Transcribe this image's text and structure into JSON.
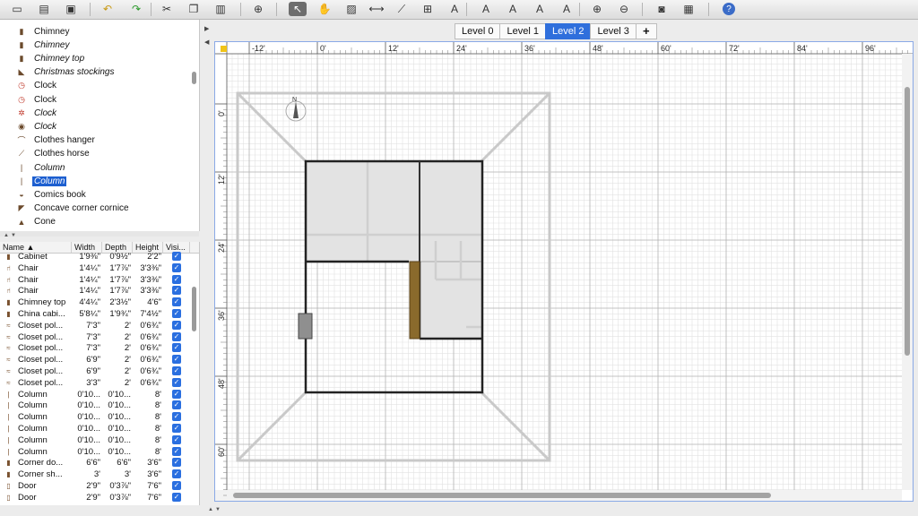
{
  "toolbar": {
    "icons": [
      "new-icon",
      "open-icon",
      "save-icon",
      "undo-icon",
      "redo-icon",
      "cut-icon",
      "copy-icon",
      "paste-icon",
      "add-furniture-icon",
      "select-icon",
      "pan-icon",
      "create-rooms-icon",
      "create-dimensions-icon",
      "create-polylines-icon",
      "create-walls-icon",
      "add-text-icon",
      "text-style-icon",
      "text-style-icon",
      "text-style-icon",
      "text-style-icon",
      "zoom-in-icon",
      "zoom-out-icon",
      "create-photo-icon",
      "create-video-icon",
      "help-icon"
    ]
  },
  "catalog": {
    "items": [
      {
        "label": "Chimney",
        "italic": false,
        "icon": "▮"
      },
      {
        "label": "Chimney",
        "italic": true,
        "icon": "▮"
      },
      {
        "label": "Chimney top",
        "italic": true,
        "icon": "▮"
      },
      {
        "label": "Christmas stockings",
        "italic": true,
        "icon": "◣"
      },
      {
        "label": "Clock",
        "italic": false,
        "icon": "◷"
      },
      {
        "label": "Clock",
        "italic": false,
        "icon": "◷"
      },
      {
        "label": "Clock",
        "italic": true,
        "icon": "✲"
      },
      {
        "label": "Clock",
        "italic": true,
        "icon": "◉"
      },
      {
        "label": "Clothes hanger",
        "italic": false,
        "icon": "⌒"
      },
      {
        "label": "Clothes horse",
        "italic": false,
        "icon": "⟋"
      },
      {
        "label": "Column",
        "italic": true,
        "icon": "|"
      },
      {
        "label": "Column",
        "italic": true,
        "icon": "|",
        "selected": true
      },
      {
        "label": "Comics book",
        "italic": false,
        "icon": "◒"
      },
      {
        "label": "Concave corner cornice",
        "italic": false,
        "icon": "◤"
      },
      {
        "label": "Cone",
        "italic": false,
        "icon": "▲"
      }
    ]
  },
  "table": {
    "headers": {
      "name": "Name ▲",
      "width": "Width",
      "depth": "Depth",
      "height": "Height",
      "visible": "Visi..."
    },
    "rows": [
      {
        "name": "Cabinet",
        "width": "1'9⅜\"",
        "depth": "0'9½\"",
        "height": "2'2\""
      },
      {
        "name": "Chair",
        "width": "1'4¼\"",
        "depth": "1'7⅞\"",
        "height": "3'3⅜\""
      },
      {
        "name": "Chair",
        "width": "1'4¼\"",
        "depth": "1'7⅞\"",
        "height": "3'3⅜\""
      },
      {
        "name": "Chair",
        "width": "1'4¼\"",
        "depth": "1'7⅞\"",
        "height": "3'3⅜\""
      },
      {
        "name": "Chimney top",
        "width": "4'4¼\"",
        "depth": "2'3½\"",
        "height": "4'6\""
      },
      {
        "name": "China cabi...",
        "width": "5'8¼\"",
        "depth": "1'9¾\"",
        "height": "7'4½\""
      },
      {
        "name": "Closet pol...",
        "width": "7'3\"",
        "depth": "2'",
        "height": "0'6¾\""
      },
      {
        "name": "Closet pol...",
        "width": "7'3\"",
        "depth": "2'",
        "height": "0'6¾\""
      },
      {
        "name": "Closet pol...",
        "width": "7'3\"",
        "depth": "2'",
        "height": "0'6¾\""
      },
      {
        "name": "Closet pol...",
        "width": "6'9\"",
        "depth": "2'",
        "height": "0'6¾\""
      },
      {
        "name": "Closet pol...",
        "width": "6'9\"",
        "depth": "2'",
        "height": "0'6¾\""
      },
      {
        "name": "Closet pol...",
        "width": "3'3\"",
        "depth": "2'",
        "height": "0'6¾\""
      },
      {
        "name": "Column",
        "width": "0'10...",
        "depth": "0'10...",
        "height": "8'"
      },
      {
        "name": "Column",
        "width": "0'10...",
        "depth": "0'10...",
        "height": "8'"
      },
      {
        "name": "Column",
        "width": "0'10...",
        "depth": "0'10...",
        "height": "8'"
      },
      {
        "name": "Column",
        "width": "0'10...",
        "depth": "0'10...",
        "height": "8'"
      },
      {
        "name": "Column",
        "width": "0'10...",
        "depth": "0'10...",
        "height": "8'"
      },
      {
        "name": "Column",
        "width": "0'10...",
        "depth": "0'10...",
        "height": "8'"
      },
      {
        "name": "Corner do...",
        "width": "6'6\"",
        "depth": "6'6\"",
        "height": "3'6\""
      },
      {
        "name": "Corner sh...",
        "width": "3'",
        "depth": "3'",
        "height": "3'6\""
      },
      {
        "name": "Door",
        "width": "2'9\"",
        "depth": "0'3⅞\"",
        "height": "7'6\""
      },
      {
        "name": "Door",
        "width": "2'9\"",
        "depth": "0'3⅞\"",
        "height": "7'6\""
      }
    ]
  },
  "levels": {
    "tabs": [
      "Level 0",
      "Level 1",
      "Level 2",
      "Level 3"
    ],
    "active": "Level 2",
    "add": "+"
  },
  "plan": {
    "ruler_x": [
      "-12'",
      "0'",
      "12'",
      "24'",
      "36'",
      "48'",
      "60'",
      "72'",
      "84'",
      "96'"
    ],
    "ruler_y": [
      "0'",
      "12'",
      "24'",
      "36'",
      "48'",
      "60'"
    ],
    "compass_label": "N"
  }
}
